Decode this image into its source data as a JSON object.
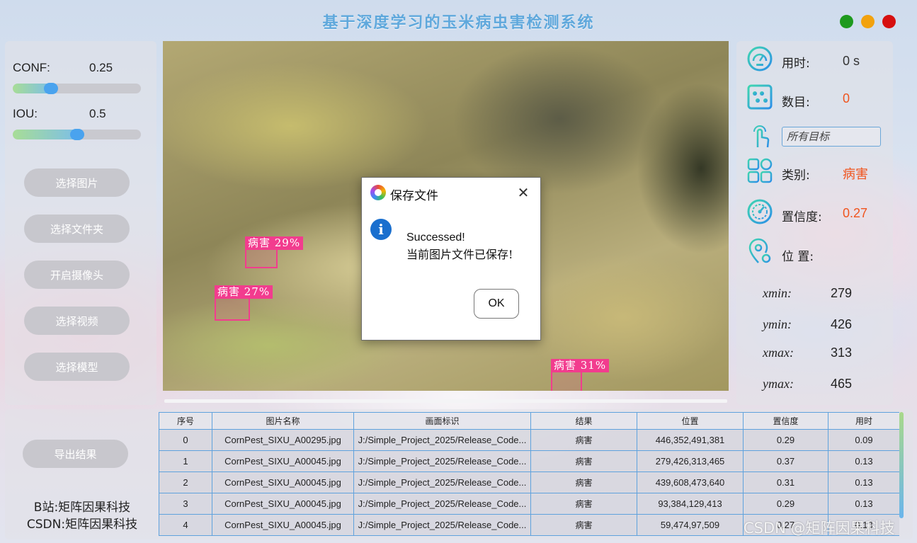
{
  "app": {
    "title": "基于深度学习的玉米病虫害检测系统"
  },
  "params": {
    "conf": {
      "label": "CONF:",
      "value": "0.25",
      "fraction": 0.25
    },
    "iou": {
      "label": "IOU:",
      "value": "0.5",
      "fraction": 0.5
    }
  },
  "buttons": {
    "select_image": "选择图片",
    "select_folder": "选择文件夹",
    "open_camera": "开启摄像头",
    "select_video": "选择视频",
    "select_model": "选择模型",
    "export": "导出结果"
  },
  "detections": [
    {
      "label": "病害  29%"
    },
    {
      "label": "病害  27%"
    },
    {
      "label": "病害  31%"
    }
  ],
  "dialog": {
    "title": "保存文件",
    "close": "✕",
    "info_glyph": "i",
    "message1": "Successed!",
    "message2": "当前图片文件已保存!",
    "ok": "OK"
  },
  "stats": {
    "time": {
      "label": "用时:",
      "value": "0 s"
    },
    "count": {
      "label": "数目:",
      "value": "0"
    },
    "target_select": "所有目标",
    "category": {
      "label": "类别:",
      "value": "病害"
    },
    "confidence": {
      "label": "置信度:",
      "value": "0.27"
    },
    "position": {
      "label": "位 置:"
    },
    "xmin": {
      "label": "xmin:",
      "value": "279"
    },
    "ymin": {
      "label": "ymin:",
      "value": "426"
    },
    "xmax": {
      "label": "xmax:",
      "value": "313"
    },
    "ymax": {
      "label": "ymax:",
      "value": "465"
    }
  },
  "credits": {
    "bilibili": "B站:矩阵因果科技",
    "csdn": "CSDN:矩阵因果科技"
  },
  "table": {
    "headers": [
      "序号",
      "图片名称",
      "画面标识",
      "结果",
      "位置",
      "置信度",
      "用时"
    ],
    "rows": [
      [
        "0",
        "CornPest_SIXU_A00295.jpg",
        "J:/Simple_Project_2025/Release_Code...",
        "病害",
        "446,352,491,381",
        "0.29",
        "0.09"
      ],
      [
        "1",
        "CornPest_SIXU_A00045.jpg",
        "J:/Simple_Project_2025/Release_Code...",
        "病害",
        "279,426,313,465",
        "0.37",
        "0.13"
      ],
      [
        "2",
        "CornPest_SIXU_A00045.jpg",
        "J:/Simple_Project_2025/Release_Code...",
        "病害",
        "439,608,473,640",
        "0.31",
        "0.13"
      ],
      [
        "3",
        "CornPest_SIXU_A00045.jpg",
        "J:/Simple_Project_2025/Release_Code...",
        "病害",
        "93,384,129,413",
        "0.29",
        "0.13"
      ],
      [
        "4",
        "CornPest_SIXU_A00045.jpg",
        "J:/Simple_Project_2025/Release_Code...",
        "病害",
        "59,474,97,509",
        "0.27",
        "0.13"
      ]
    ]
  },
  "watermark": "CSDN @矩阵因果科技",
  "colors": {
    "title": "#5fa8dc",
    "accent_red": "#f0541e",
    "detection": "#f23c8e",
    "table_border": "#5fa2dd"
  }
}
